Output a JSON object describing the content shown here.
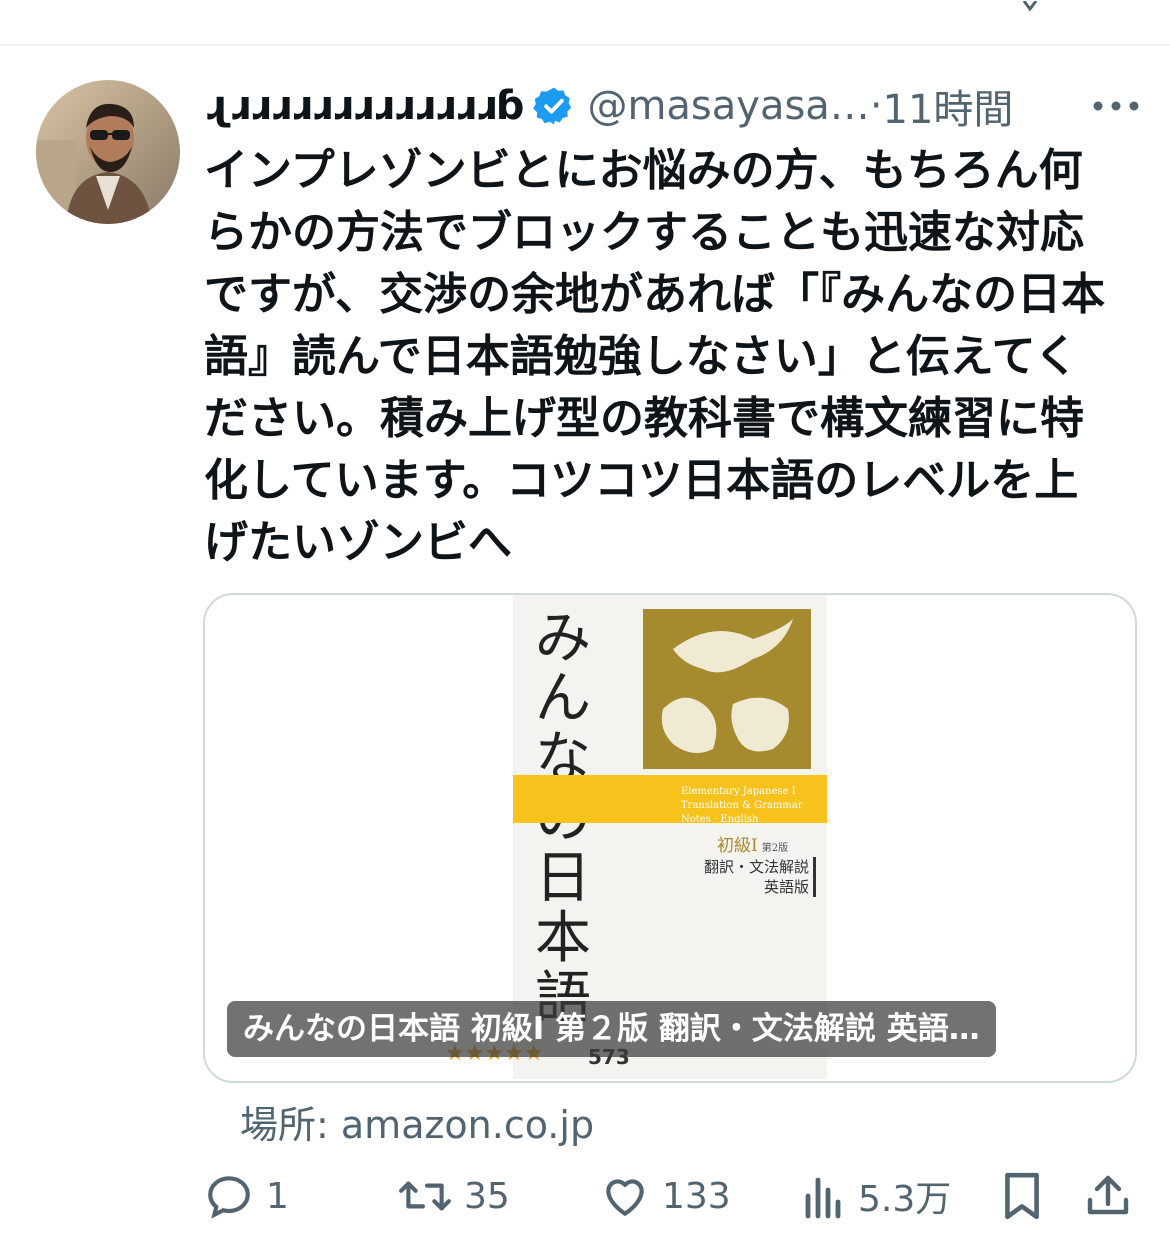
{
  "tweet": {
    "author": {
      "display_name": "ɺɹɹɹɹɹɹɹɹɹɹɹɹɹɹɓ",
      "display_name_render": "ɻɹɹɹɹɹɹɹɹɹɹɹɹɹɓ",
      "handle": "@masayasa…",
      "verified": true
    },
    "separator": "·",
    "time": "11時間",
    "text": "インプレゾンビとにお悩みの方、もちろん何らかの方法でブロックすることも迅速な対応ですが、交渉の余地があれば「『みんなの日本語』読んで日本語勉強しなさい」と伝えてください。積み上げ型の教科書で構文練習に特化しています。コツコツ日本語のレベルを上げたいゾンビへ",
    "card": {
      "title": "みんなの日本語 初級I 第２版 翻訳・文法解説 英語…",
      "source_prefix": "場所: ",
      "source_domain": "amazon.co.jp",
      "image": {
        "vertical_title": "みんなの日本語",
        "band_text_1": "Elementary Japanese I",
        "band_text_2": "Translation & Grammar Notes · English",
        "level": "初級Ⅰ",
        "edition": "第2版",
        "sub_1": "翻訳・文法解説",
        "sub_2": "英語版",
        "stars": "★★★★★",
        "rating": 4.5,
        "review_count": "573"
      }
    },
    "actions": {
      "reply_count": "1",
      "retweet_count": "35",
      "like_count": "133",
      "view_count": "5.3万"
    }
  },
  "colors": {
    "text_primary": "#0f1419",
    "text_secondary": "#536471",
    "verified_blue": "#1d9bf0",
    "border": "#cfd9de"
  }
}
